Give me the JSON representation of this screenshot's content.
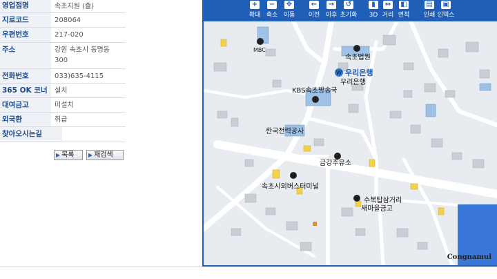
{
  "info": {
    "rows": [
      {
        "label": "영업점명",
        "value": "속초지원 (출)"
      },
      {
        "label": "지로코드",
        "value": "208064"
      },
      {
        "label": "우편번호",
        "value": "217-020"
      },
      {
        "label": "주소",
        "value": "강원 속초시 동명동",
        "value2": "300"
      },
      {
        "label": "전화번호",
        "value": "033)635-4115"
      },
      {
        "label": "365 OK 코너",
        "value": "설치"
      },
      {
        "label": "대여금고",
        "value": "미설치"
      },
      {
        "label": "외국환",
        "value": "취급"
      },
      {
        "label": "찾아오시는길",
        "value": ""
      }
    ],
    "buttons": {
      "list": "목록",
      "research": "재검색"
    }
  },
  "map": {
    "toolbar": [
      {
        "label": "확대",
        "icon": "zoom-in-icon",
        "glyph": "+"
      },
      {
        "label": "축소",
        "icon": "zoom-out-icon",
        "glyph": "−"
      },
      {
        "label": "이동",
        "icon": "move-icon",
        "glyph": "✥"
      },
      {
        "label": "이전",
        "icon": "back-icon",
        "glyph": "←"
      },
      {
        "label": "이후",
        "icon": "forward-icon",
        "glyph": "→"
      },
      {
        "label": "초기화",
        "icon": "reset-icon",
        "glyph": "↺"
      },
      {
        "label": "3D",
        "icon": "3d-icon",
        "glyph": "▮"
      },
      {
        "label": "거리",
        "icon": "distance-icon",
        "glyph": "↔"
      },
      {
        "label": "면적",
        "icon": "area-icon",
        "glyph": "◧"
      },
      {
        "label": "인쇄",
        "icon": "print-icon",
        "glyph": "▤"
      },
      {
        "label": "인덱스",
        "icon": "index-icon",
        "glyph": "▣"
      }
    ],
    "labels": {
      "mbc": "MBC",
      "court": "속초법원",
      "bank_brand": "우리은행",
      "bank": "우리은행",
      "kbs": "KBS속초방송국",
      "kepco": "한국전력공사",
      "gas": "금강주유소",
      "terminal": "속초시외버스터미널",
      "tower": "수복탑삼거리",
      "saemaeul": "새마을금고"
    },
    "logo": "Congnamul",
    "colors": {
      "toolbar": "#1f5fb8",
      "water": "#3a78d8",
      "building": "#c9cdd4",
      "accent_building": "#9ec1e6",
      "yellow": "#f2d24a"
    }
  }
}
